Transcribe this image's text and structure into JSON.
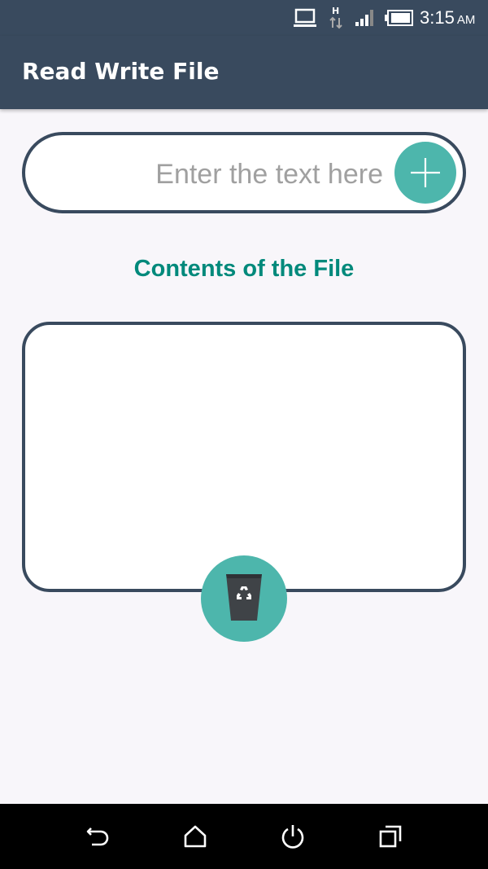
{
  "status_bar": {
    "time": "3:15",
    "ampm": "AM",
    "icons": [
      "laptop-icon",
      "network-h-icon",
      "signal-icon",
      "battery-icon"
    ]
  },
  "app_bar": {
    "title": "Read Write File",
    "background_color": "#394a5e"
  },
  "input": {
    "placeholder": "Enter the text here",
    "value": "",
    "add_icon": "plus-icon"
  },
  "contents": {
    "heading": "Contents of the File",
    "text": "",
    "heading_color": "#00897b"
  },
  "delete_button": {
    "icon": "recycle-bin-icon",
    "color": "#4db6ac"
  },
  "nav_bar": {
    "items": [
      "back-icon",
      "home-icon",
      "power-icon",
      "recents-icon"
    ]
  }
}
